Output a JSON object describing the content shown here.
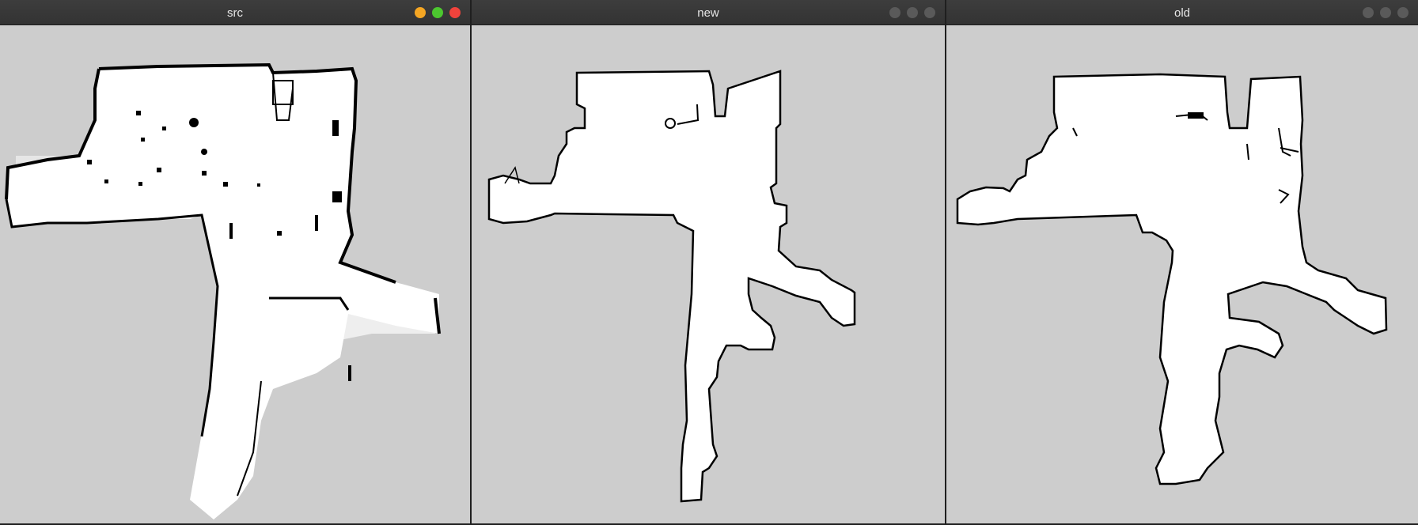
{
  "windows": [
    {
      "title": "src",
      "controls": [
        "minimize-button",
        "maximize-button",
        "close-button"
      ],
      "control_colors": [
        "#f5a623",
        "#4cc72f",
        "#f0433c"
      ]
    },
    {
      "title": "new",
      "controls": [
        "minimize-button",
        "maximize-button",
        "close-button"
      ],
      "control_colors": [
        "#5a5a5a",
        "#5a5a5a",
        "#5a5a5a"
      ]
    },
    {
      "title": "old",
      "controls": [
        "minimize-button",
        "maximize-button",
        "close-button"
      ],
      "control_colors": [
        "#5a5a5a",
        "#5a5a5a",
        "#5a5a5a"
      ]
    }
  ],
  "colors": {
    "background": "#cdcdcd",
    "free_space": "#ffffff",
    "obstacle": "#000000"
  }
}
